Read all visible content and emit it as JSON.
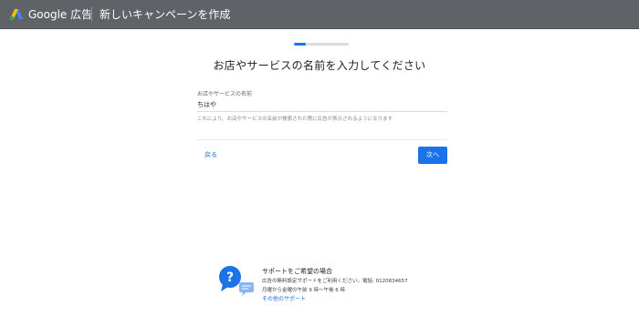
{
  "header": {
    "brand": "Google 広告",
    "page_heading": "新しいキャンペーンを作成",
    "logo_icon": "google-ads-logo-icon"
  },
  "progress": {
    "fraction": 0.22,
    "color": "#1a73e8"
  },
  "step": {
    "title": "お店やサービスの名前を入力してください",
    "field_label": "お店やサービスの名前",
    "field_value": "ちはや",
    "field_hint": "これにより、お店やサービスの名前が検索された際に広告が表示されるようになります"
  },
  "nav": {
    "back_label": "戻る",
    "next_label": "次へ"
  },
  "support": {
    "icon": "support-chat-icon",
    "title": "サポートをご希望の場合",
    "line1": "広告の無料設定サポートをご利用ください。電話: 0120834657",
    "line2": "月曜から金曜の午前 9 時〜午後 6 時",
    "link": "その他のサポート"
  },
  "colors": {
    "accent": "#1a73e8",
    "header_bg": "#5f6368"
  }
}
